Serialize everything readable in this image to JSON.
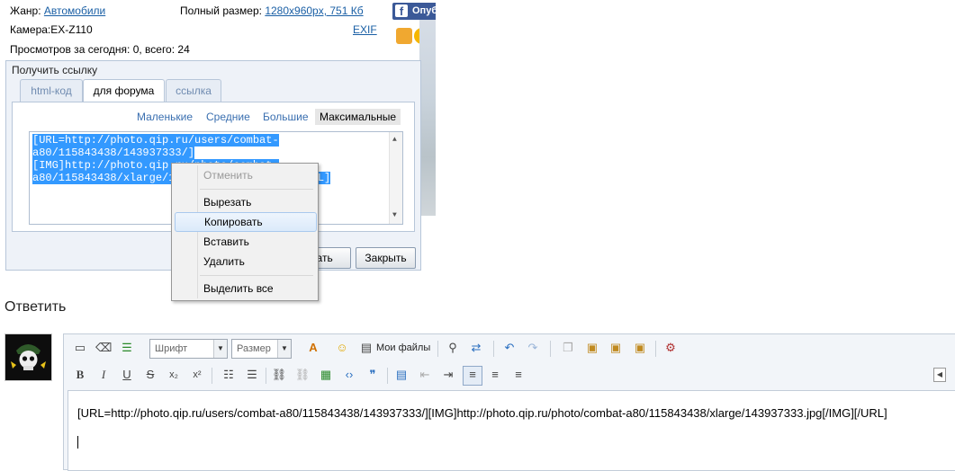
{
  "info": {
    "genre_label": "Жанр:",
    "genre_value": "Автомобили",
    "fullsize_label": "Полный размер:",
    "fullsize_value": "1280x960px, 751 Кб",
    "camera": "Камера:EX-Z110",
    "views": "Просмотров за сегодня: 0, всего: 24",
    "exif": "EXIF",
    "fb_label": "Опуб"
  },
  "dialog": {
    "title": "Получить ссылку",
    "tabs": [
      "html-код",
      "для форума",
      "ссылка"
    ],
    "sizes": [
      "Маленькие",
      "Средние",
      "Большие",
      "Максимальные"
    ],
    "code_line1": "[URL=http://photo.qip.ru/users/combat-a80/115843438/143937333/]",
    "code_line2": "[IMG]http://photo.qip.ru/photo/combat-",
    "code_line3": "a80/115843438/xlarge/143937333.jpg[/IMG][/URL]",
    "copy_button_partial": "вать",
    "close_button": "Закрыть"
  },
  "context_menu": {
    "items": [
      "Отменить",
      "Вырезать",
      "Копировать",
      "Вставить",
      "Удалить",
      "Выделить все"
    ]
  },
  "reply": {
    "title": "Ответить",
    "font_placeholder": "Шрифт",
    "size_placeholder": "Размер",
    "my_files": "Мои файлы",
    "editor_text": "[URL=http://photo.qip.ru/users/combat-a80/115843438/143937333/][IMG]http://photo.qip.ru/photo/combat-a80/115843438/xlarge/143937333.jpg[/IMG][/URL]"
  },
  "colors": {
    "link": "#1a5fa5",
    "selection": "#3399ff",
    "facebook": "#3b5998"
  }
}
